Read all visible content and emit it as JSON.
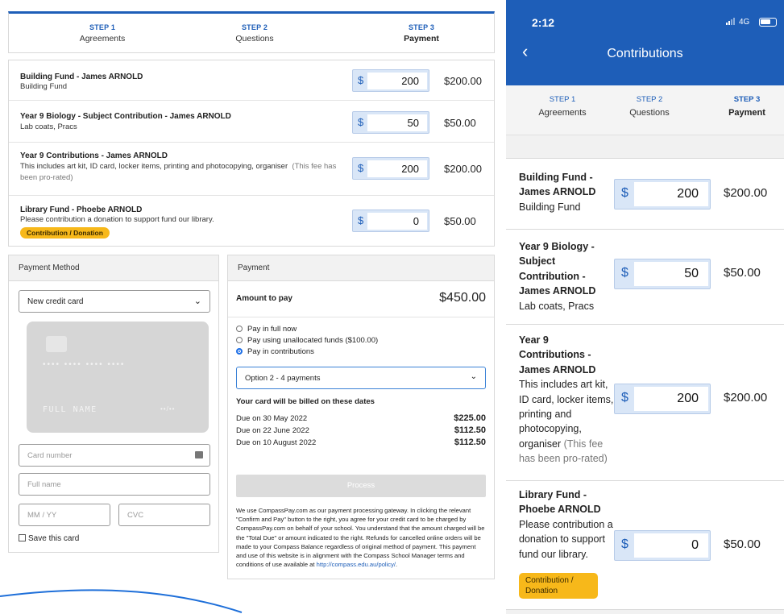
{
  "steps": [
    {
      "num": "STEP 1",
      "label": "Agreements"
    },
    {
      "num": "STEP 2",
      "label": "Questions"
    },
    {
      "num": "STEP 3",
      "label": "Payment"
    }
  ],
  "fees": [
    {
      "title": "Building Fund - James ARNOLD",
      "desc": "Building Fund",
      "note": "",
      "amount_input": "200",
      "amount": "$200.00",
      "badge": ""
    },
    {
      "title": "Year 9 Biology - Subject Contribution - James ARNOLD",
      "desc": "Lab coats, Pracs",
      "note": "",
      "amount_input": "50",
      "amount": "$50.00",
      "badge": ""
    },
    {
      "title": "Year 9 Contributions - James ARNOLD",
      "desc": "This includes art kit, ID card, locker items, printing and photocopying, organiser",
      "note": "(This fee has been pro-rated)",
      "amount_input": "200",
      "amount": "$200.00",
      "badge": ""
    },
    {
      "title": "Library Fund - Phoebe ARNOLD",
      "desc": "Please contribution a donation to support fund our library.",
      "note": "",
      "amount_input": "0",
      "amount": "$50.00",
      "badge": "Contribution / Donation"
    }
  ],
  "currency_symbol": "$",
  "payment_method": {
    "header": "Payment Method",
    "selected": "New credit card",
    "card_preview": {
      "number_mask": "•••• •••• •••• ••••",
      "name": "FULL NAME",
      "expiry": "••/••"
    },
    "card_number_placeholder": "Card number",
    "full_name_placeholder": "Full name",
    "expiry_placeholder": "MM / YY",
    "cvc_placeholder": "CVC",
    "save_card_label": "Save this card"
  },
  "payment": {
    "header": "Payment",
    "amount_label": "Amount to pay",
    "amount_value": "$450.00",
    "options": [
      {
        "label": "Pay in full now",
        "selected": false
      },
      {
        "label": "Pay using unallocated funds ($100.00)",
        "selected": false
      },
      {
        "label": "Pay in contributions",
        "selected": true
      }
    ],
    "plan_selected": "Option 2 - 4 payments",
    "billing_heading": "Your card will be billed on these dates",
    "schedule": [
      {
        "label": "Due on 30 May 2022",
        "value": "$225.00"
      },
      {
        "label": "Due on 22 June 2022",
        "value": "$112.50"
      },
      {
        "label": "Due on 10 August 2022",
        "value": "$112.50"
      }
    ],
    "process_label": "Process",
    "legal_text": "We use CompassPay.com as our payment processing gateway. In clicking the relevant \"Confirm and Pay\" button to the right, you agree for your credit card to be charged by CompassPay.com on behalf of your school. You understand that the amount charged will be the \"Total Due\" or amount indicated to the right. Refunds for cancelled online orders will be made to your Compass Balance regardless of original method of payment. This payment and use of this website is in alignment with the Compass School Manager terms and conditions of use available at",
    "legal_link": "http://compass.edu.au/policy/",
    "legal_end": "."
  },
  "mobile": {
    "time": "2:12",
    "network": "4G",
    "title": "Contributions",
    "fees": [
      {
        "title": "Building Fund - James ARNOLD",
        "desc": "Building Fund",
        "note": "",
        "amount_input": "200",
        "amount": "$200.00",
        "badge": ""
      },
      {
        "title": "Year 9 Biology - Subject Contribution - James ARNOLD",
        "desc": "Lab coats, Pracs",
        "note": "",
        "amount_input": "50",
        "amount": "$50.00",
        "badge": ""
      },
      {
        "title": "Year 9 Contributions - James ARNOLD",
        "desc": "This includes art kit, ID card, locker items, printing and photocopying, organiser",
        "note": "(This fee has been pro-rated)",
        "amount_input": "200",
        "amount": "$200.00",
        "badge": ""
      },
      {
        "title": "Library Fund - Phoebe ARNOLD",
        "desc": "Please contribution a donation to support fund our library.",
        "note": "",
        "amount_input": "0",
        "amount": "$50.00",
        "badge": "Contribution / Donation"
      }
    ]
  },
  "colors": {
    "brand": "#1e5eb8",
    "badge": "#f7b81a",
    "radio_on": "#1e6fe6"
  }
}
